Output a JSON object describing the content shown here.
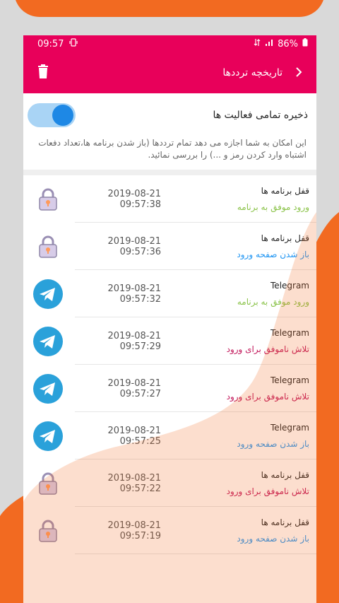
{
  "status_bar": {
    "time": "09:57",
    "battery": "86%"
  },
  "app_bar": {
    "title": "تاریخچه ترددها"
  },
  "settings": {
    "save_all_label": "ذخیره تمامی فعالیت ها",
    "save_all_enabled": true,
    "description": "این امکان به شما اجازه می دهد تمام ترددها (باز شدن برنامه ها،تعداد دفعات اشتباه وارد کردن رمز و ...) را بررسی نمائید."
  },
  "colors": {
    "primary": "#e8005a",
    "orange": "#f26a21",
    "success": "#8bc34a",
    "fail": "#c2185b",
    "open": "#2196f3"
  },
  "history": [
    {
      "app": "قفل برنامه ها",
      "status": "ورود موفق به برنامه",
      "status_type": "success",
      "time": "2019-08-21 09:57:38",
      "icon": "lock-icon"
    },
    {
      "app": "قفل برنامه ها",
      "status": "باز شدن صفحه ورود",
      "status_type": "open",
      "time": "2019-08-21 09:57:36",
      "icon": "lock-icon"
    },
    {
      "app": "Telegram",
      "status": "ورود موفق به برنامه",
      "status_type": "success",
      "time": "2019-08-21 09:57:32",
      "icon": "telegram-icon"
    },
    {
      "app": "Telegram",
      "status": "تلاش ناموفق برای ورود",
      "status_type": "fail",
      "time": "2019-08-21 09:57:29",
      "icon": "telegram-icon"
    },
    {
      "app": "Telegram",
      "status": "تلاش ناموفق برای ورود",
      "status_type": "fail",
      "time": "2019-08-21 09:57:27",
      "icon": "telegram-icon"
    },
    {
      "app": "Telegram",
      "status": "باز شدن صفحه ورود",
      "status_type": "open",
      "time": "2019-08-21 09:57:25",
      "icon": "telegram-icon"
    },
    {
      "app": "قفل برنامه ها",
      "status": "تلاش ناموفق برای ورود",
      "status_type": "fail",
      "time": "2019-08-21 09:57:22",
      "icon": "lock-icon"
    },
    {
      "app": "قفل برنامه ها",
      "status": "باز شدن صفحه ورود",
      "status_type": "open",
      "time": "2019-08-21 09:57:19",
      "icon": "lock-icon"
    }
  ]
}
